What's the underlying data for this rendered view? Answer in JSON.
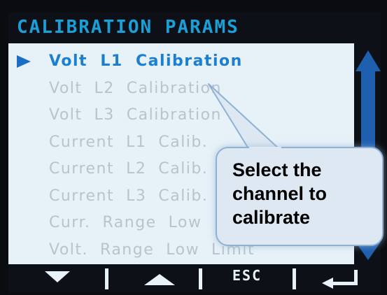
{
  "screen": {
    "title": "CALIBRATION PARAMS",
    "selected_index": 0,
    "items": [
      {
        "label": "Volt  L1  Calibration",
        "selected": true
      },
      {
        "label": "Volt  L2  Calibration",
        "selected": false
      },
      {
        "label": "Volt  L3  Calibration",
        "selected": false
      },
      {
        "label": "Current  L1  Calib.",
        "selected": false
      },
      {
        "label": "Current  L2  Calib.",
        "selected": false
      },
      {
        "label": "Current  L3  Calib.",
        "selected": false
      },
      {
        "label": "Curr.  Range  Low",
        "selected": false
      },
      {
        "label": "Volt.  Range  Low  Limit",
        "selected": false
      }
    ],
    "scroll_position": 0.0
  },
  "softkeys": {
    "down_icon": "down-arrow-icon",
    "up_icon": "up-arrow-icon",
    "esc_label": "ESC",
    "enter_icon": "enter-icon"
  },
  "callout": {
    "text": "Select the channel to calibrate"
  },
  "colors": {
    "title": "#1aa0d8",
    "selected_item": "#1a7fd0",
    "item": "#b8c4cc",
    "screen_bg": "#e7f1f8",
    "scrollbar": "#1e5fb0",
    "callout_bg": "#dde8f2",
    "callout_border": "#8fb1d4"
  }
}
